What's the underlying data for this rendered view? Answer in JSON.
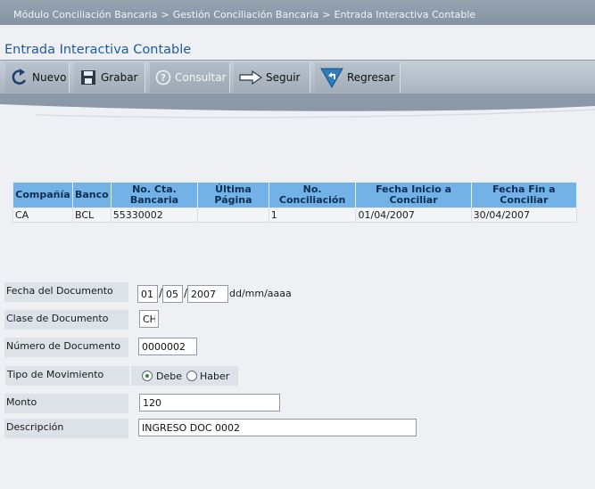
{
  "breadcrumb": [
    "Módulo Conciliación Bancaria",
    "Gestión Conciliación Bancaria",
    "Entrada Interactiva Contable"
  ],
  "breadcrumb_separator": ">",
  "page_title": "Entrada Interactiva Contable",
  "toolbar": {
    "nuevo": "Nuevo",
    "grabar": "Grabar",
    "consultar": "Consultar",
    "seguir": "Seguir",
    "regresar": "Regresar"
  },
  "table": {
    "headers": [
      "Compañía",
      "Banco",
      "No. Cta. Bancaria",
      "Última Página",
      "No. Conciliación",
      "Fecha Inicio a Conciliar",
      "Fecha Fin a Conciliar"
    ],
    "rows": [
      [
        "CA",
        "BCL",
        "55330002",
        "",
        "1",
        "01/04/2007",
        "30/04/2007"
      ]
    ]
  },
  "form": {
    "fecha_label": "Fecha del Documento",
    "fecha_day": "01",
    "fecha_month": "05",
    "fecha_year": "2007",
    "date_separator": "/",
    "fecha_format": "dd/mm/aaaa",
    "clase_label": "Clase de Documento",
    "clase_value": "CH",
    "numero_label": "Número de Documento",
    "numero_value": "0000002",
    "tipo_label": "Tipo de Movimiento",
    "tipo_options": [
      "Debe",
      "Haber"
    ],
    "tipo_selected": "Debe",
    "monto_label": "Monto",
    "monto_value": "120",
    "descripcion_label": "Descripción",
    "descripcion_value": "INGRESO DOC 0002"
  },
  "colors": {
    "title_blue": "#1e5b9e",
    "table_header": "#72b2e6",
    "radio_checked": "#2f8a2f"
  },
  "icons": [
    "new-doc-refresh-icon",
    "save-icon",
    "help-icon",
    "arrow-right-icon",
    "return-arrow-icon"
  ]
}
